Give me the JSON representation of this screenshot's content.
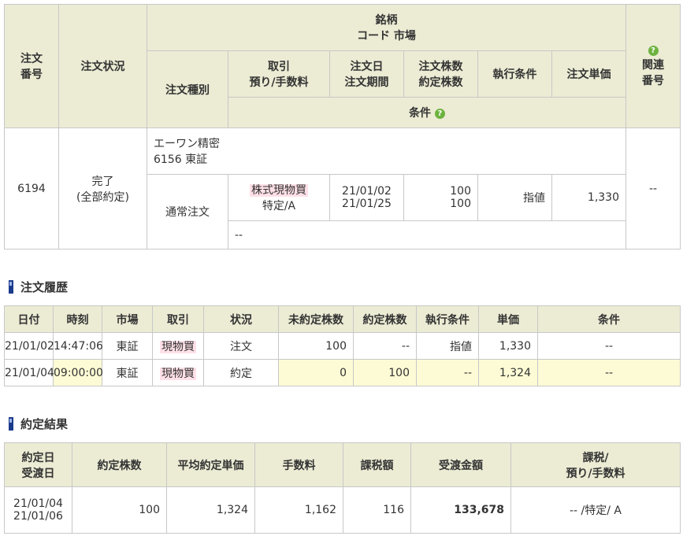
{
  "order_table": {
    "headers": {
      "order_no": [
        "注文",
        "番号"
      ],
      "order_status": "注文状況",
      "issue": [
        "銘柄",
        "コード  市場"
      ],
      "order_type": "注文種別",
      "trade": [
        "取引",
        "預り/手数料"
      ],
      "order_date": [
        "注文日",
        "注文期間"
      ],
      "qty": [
        "注文株数",
        "約定株数"
      ],
      "exec_cond": "執行条件",
      "unit_price": "注文単価",
      "condition": "条件",
      "related": [
        "関連",
        "番号"
      ]
    },
    "row": {
      "order_no": "6194",
      "status_line1": "完了",
      "status_line2": "(全部約定)",
      "issue_name": "エーワン精密",
      "issue_code_market": "6156  東証",
      "order_type": "通常注文",
      "trade_kind": "株式現物買",
      "account": "特定/A",
      "order_date": "21/01/02",
      "order_period": "21/01/25",
      "order_qty": "100",
      "filled_qty": "100",
      "exec_cond": "指値",
      "unit_price": "1,330",
      "related": "--",
      "condition": "--"
    }
  },
  "history": {
    "title": "注文履歴",
    "headers": [
      "日付",
      "時刻",
      "市場",
      "取引",
      "状況",
      "未約定株数",
      "約定株数",
      "執行条件",
      "単価",
      "条件"
    ],
    "rows": [
      [
        "21/01/02",
        "14:47:06",
        "東証",
        "現物買",
        "注文",
        "100",
        "--",
        "指値",
        "1,330",
        "--"
      ],
      [
        "21/01/04",
        "09:00:00",
        "東証",
        "現物買",
        "約定",
        "0",
        "100",
        "--",
        "1,324",
        "--"
      ]
    ]
  },
  "result": {
    "title": "約定結果",
    "headers": {
      "date": [
        "約定日",
        "受渡日"
      ],
      "qty": "約定株数",
      "avg_price": "平均約定単価",
      "fee": "手数料",
      "tax": "課税額",
      "amount": "受渡金額",
      "tax_acct": [
        "課税/",
        "預り/手数料"
      ]
    },
    "row": {
      "exec_date": "21/01/04",
      "delivery_date": "21/01/06",
      "qty": "100",
      "avg_price": "1,324",
      "fee": "1,162",
      "tax": "116",
      "amount": "133,678",
      "tax_acct": "-- /特定/ A"
    }
  },
  "icons": {
    "help": "?"
  },
  "colors": {
    "header_bg": "#ecebd4",
    "highlight": "#ffe0e8",
    "exec_row": "#fdfbd5",
    "help_green": "#6db33f",
    "section_bar": "#1a3a8c"
  }
}
